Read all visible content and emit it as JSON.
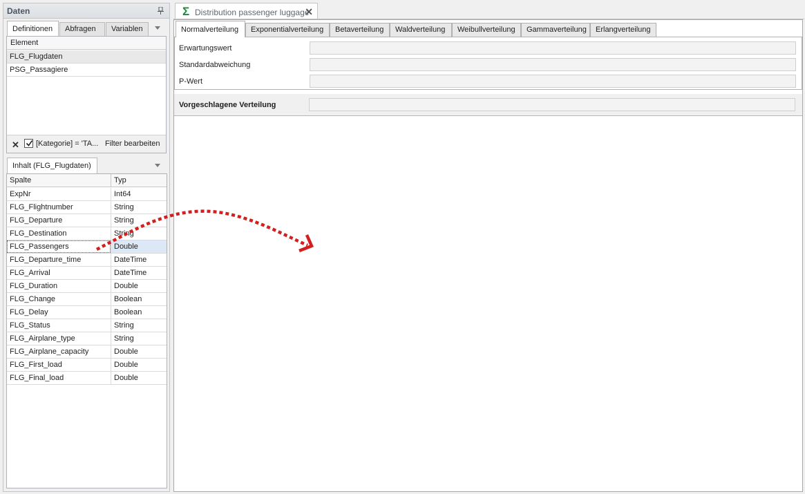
{
  "left_panel": {
    "title": "Daten",
    "tabs": [
      {
        "label": "Definitionen",
        "active": true
      },
      {
        "label": "Abfragen",
        "active": false
      },
      {
        "label": "Variablen",
        "active": false
      }
    ],
    "element_grid": {
      "header": "Element",
      "rows": [
        "FLG_Flugdaten",
        "PSG_Passagiere"
      ],
      "selected_row": 0
    },
    "filter": {
      "text": "[Kategorie] = 'TA...",
      "edit_label": "Filter bearbeiten"
    },
    "content_tab": "Inhalt (FLG_Flugdaten)",
    "columns_grid": {
      "headers": [
        "Spalte",
        "Typ"
      ],
      "rows": [
        [
          "ExpNr",
          "Int64"
        ],
        [
          "FLG_Flightnumber",
          "String"
        ],
        [
          "FLG_Departure",
          "String"
        ],
        [
          "FLG_Destination",
          "String"
        ],
        [
          "FLG_Passengers",
          "Double"
        ],
        [
          "FLG_Departure_time",
          "DateTime"
        ],
        [
          "FLG_Arrival",
          "DateTime"
        ],
        [
          "FLG_Duration",
          "Double"
        ],
        [
          "FLG_Change",
          "Boolean"
        ],
        [
          "FLG_Delay",
          "Boolean"
        ],
        [
          "FLG_Status",
          "String"
        ],
        [
          "FLG_Airplane_type",
          "String"
        ],
        [
          "FLG_Airplane_capacity",
          "Double"
        ],
        [
          "FLG_First_load",
          "Double"
        ],
        [
          "FLG_Final_load",
          "Double"
        ]
      ],
      "highlighted_row": 4
    }
  },
  "document": {
    "tab_title": "Distribution passenger luggage",
    "tab_icon": "sigma-icon",
    "dist_tabs": [
      "Normalverteilung",
      "Exponentialverteilung",
      "Betaverteilung",
      "Waldverteilung",
      "Weibullverteilung",
      "Gammaverteilung",
      "Erlangverteilung"
    ],
    "active_dist_tab": 0,
    "fields": [
      {
        "label": "Erwartungswert",
        "value": ""
      },
      {
        "label": "Standardabweichung",
        "value": ""
      },
      {
        "label": "P-Wert",
        "value": ""
      }
    ],
    "suggestion": {
      "label": "Vorgeschlagene Verteilung",
      "value": ""
    }
  },
  "colors": {
    "sigma": "#1a8b3a",
    "drag_arrow": "#d22020",
    "highlight": "#dde8f6"
  }
}
